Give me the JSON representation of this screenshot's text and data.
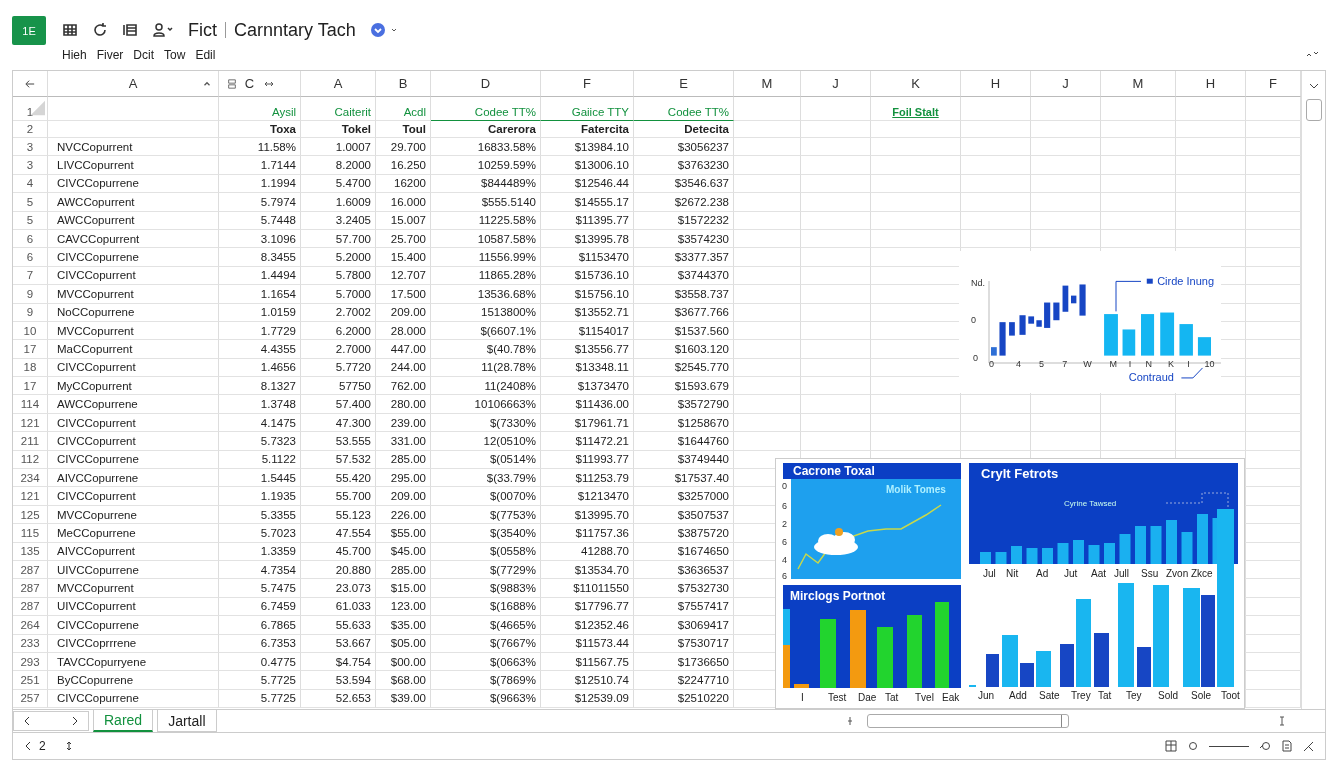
{
  "app": {
    "logo": "1E",
    "short_title": "Fict",
    "title": "Carnntary Tach"
  },
  "menu": [
    "Hieh",
    "Fiver",
    "Dcit",
    "Tow",
    "Edil"
  ],
  "sheet": {
    "columns": [
      "A",
      "C",
      "A",
      "B",
      "D",
      "F",
      "E",
      "M",
      "J",
      "K",
      "H",
      "J",
      "M",
      "H",
      "F"
    ],
    "header_rows": [
      {
        "row": "1",
        "kind": "accent",
        "cells": [
          "Aysil",
          "Caiterit",
          "Acdl",
          "Codee TT%",
          "Gaiice TTY",
          "Codee TT%"
        ],
        "link": "Foil Stalt"
      },
      {
        "row": "2",
        "kind": "bold",
        "cells": [
          "Toxa",
          "Tokel",
          "Toul",
          "Carerora",
          "Fatercita",
          "Detecita"
        ]
      }
    ],
    "rows": [
      {
        "row": "3",
        "name": "NVCCopurrent",
        "values": [
          "11.58%",
          "1.0007",
          "29.700",
          "16833.58%",
          "$13984.10",
          "$3056237"
        ]
      },
      {
        "row": "3",
        "name": "LIVCCopurrent",
        "values": [
          "1.7144",
          "8.2000",
          "16.250",
          "10259.59%",
          "$13006.10",
          "$3763230"
        ]
      },
      {
        "row": "4",
        "name": "CIVCCopurrene",
        "values": [
          "1.1994",
          "5.4700",
          "16200",
          "$844489%",
          "$12546.44",
          "$3546.637"
        ]
      },
      {
        "row": "5",
        "name": "AWCCopurrent",
        "values": [
          "5.7974",
          "1.6009",
          "16.000",
          "$555.5140",
          "$14555.17",
          "$2672.238"
        ]
      },
      {
        "row": "5",
        "name": "AWCCopurrent",
        "values": [
          "5.7448",
          "3.2405",
          "15.007",
          "11225.58%",
          "$11395.77",
          "$1572232"
        ]
      },
      {
        "row": "6",
        "name": "CAVCCopurrent",
        "values": [
          "3.1096",
          "57.700",
          "25.700",
          "10587.58%",
          "$13995.78",
          "$3574230"
        ]
      },
      {
        "row": "6",
        "name": "CIVCCopurrene",
        "values": [
          "8.3455",
          "5.2000",
          "15.400",
          "11556.99%",
          "$1153470",
          "$3377.357"
        ]
      },
      {
        "row": "7",
        "name": "CIVCCopurrent",
        "values": [
          "1.4494",
          "5.7800",
          "12.707",
          "11865.28%",
          "$15736.10",
          "$3744370"
        ]
      },
      {
        "row": "9",
        "name": "MVCCopurrent",
        "values": [
          "1.1654",
          "5.7000",
          "17.500",
          "13536.68%",
          "$15756.10",
          "$3558.737"
        ]
      },
      {
        "row": "9",
        "name": "NoCCopurrene",
        "values": [
          "1.0159",
          "2.7002",
          "209.00",
          "1513800%",
          "$13552.71",
          "$3677.766"
        ]
      },
      {
        "row": "10",
        "name": "MVCCopurrent",
        "values": [
          "1.7729",
          "6.2000",
          "28.000",
          "$(6607.1%",
          "$1154017",
          "$1537.560"
        ]
      },
      {
        "row": "17",
        "name": "MaCCopurrent",
        "values": [
          "4.4355",
          "2.7000",
          "447.00",
          "$(40.78%",
          "$13556.77",
          "$1603.120"
        ]
      },
      {
        "row": "18",
        "name": "CIVCCopurrent",
        "values": [
          "1.4656",
          "5.7720",
          "244.00",
          "11(28.78%",
          "$13348.11",
          "$2545.770"
        ]
      },
      {
        "row": "17",
        "name": "MyCCopurrent",
        "values": [
          "8.1327",
          "57750",
          "762.00",
          "11(2408%",
          "$1373470",
          "$1593.679"
        ]
      },
      {
        "row": "114",
        "name": "AWCCopurrene",
        "values": [
          "1.3748",
          "57.400",
          "280.00",
          "10106663%",
          "$11436.00",
          "$3572790"
        ]
      },
      {
        "row": "121",
        "name": "CIVCCopurrent",
        "values": [
          "4.1475",
          "47.300",
          "239.00",
          "$(7330%",
          "$17961.71",
          "$1258670"
        ]
      },
      {
        "row": "211",
        "name": "CIVCCopurrent",
        "values": [
          "5.7323",
          "53.555",
          "331.00",
          "12(0510%",
          "$11472.21",
          "$1644760"
        ]
      },
      {
        "row": "112",
        "name": "CIVCCopurrene",
        "values": [
          "5.1122",
          "57.532",
          "285.00",
          "$(0514%",
          "$11993.77",
          "$3749440"
        ]
      },
      {
        "row": "234",
        "name": "AIVCCopurrene",
        "values": [
          "1.5445",
          "55.420",
          "295.00",
          "$(33.79%",
          "$11253.79",
          "$17537.40"
        ]
      },
      {
        "row": "121",
        "name": "CIVCCopurrent",
        "values": [
          "1.1935",
          "55.700",
          "209.00",
          "$(0070%",
          "$1213470",
          "$3257000"
        ]
      },
      {
        "row": "125",
        "name": "MVCCopurrene",
        "values": [
          "5.3355",
          "55.123",
          "226.00",
          "$(7753%",
          "$13995.70",
          "$3507537"
        ]
      },
      {
        "row": "115",
        "name": "MeCCopurrene",
        "values": [
          "5.7023",
          "47.554",
          "$55.00",
          "$(3540%",
          "$11757.36",
          "$3875720"
        ]
      },
      {
        "row": "135",
        "name": "AIVCCopurrent",
        "values": [
          "1.3359",
          "45.700",
          "$45.00",
          "$(0558%",
          "41288.70",
          "$1674650"
        ]
      },
      {
        "row": "287",
        "name": "UIVCCopurrene",
        "values": [
          "4.7354",
          "20.880",
          "285.00",
          "$(7729%",
          "$13534.70",
          "$3636537"
        ]
      },
      {
        "row": "287",
        "name": "MVCCopurrent",
        "values": [
          "5.7475",
          "23.073",
          "$15.00",
          "$(9883%",
          "$11011550",
          "$7532730"
        ]
      },
      {
        "row": "287",
        "name": "UIVCCopurrent",
        "values": [
          "6.7459",
          "61.033",
          "123.00",
          "$(1688%",
          "$17796.77",
          "$7557417"
        ]
      },
      {
        "row": "264",
        "name": "CIVCCopurrene",
        "values": [
          "6.7865",
          "55.633",
          "$35.00",
          "$(4665%",
          "$12352.46",
          "$3069417"
        ]
      },
      {
        "row": "233",
        "name": "CIVCCoprrrene",
        "values": [
          "6.7353",
          "53.667",
          "$05.00",
          "$(7667%",
          "$11573.44",
          "$7530717"
        ]
      },
      {
        "row": "293",
        "name": "TAVCCopurryene",
        "values": [
          "0.4775",
          "$4.754",
          "$00.00",
          "$(0663%",
          "$11567.75",
          "$1736650"
        ]
      },
      {
        "row": "251",
        "name": "ByCCopurrene",
        "values": [
          "5.7725",
          "53.594",
          "$68.00",
          "$(7869%",
          "$12510.74",
          "$2247710"
        ]
      },
      {
        "row": "257",
        "name": "CIVCCopurrene",
        "values": [
          "5.7725",
          "52.653",
          "$39.00",
          "$(9663%",
          "$12539.09",
          "$2510220"
        ]
      }
    ]
  },
  "small_chart": {
    "y_labels": [
      "Nd.",
      "0",
      "0"
    ],
    "x_labels": [
      "0",
      "4",
      "5",
      "7",
      "W",
      "M",
      "I",
      "N",
      "K",
      "I",
      "10"
    ],
    "legend": "Cirde Inung",
    "note": "Contraud"
  },
  "dashboard": {
    "line_panel": {
      "title": "Cacrone Toxal",
      "y_ticks": [
        "0",
        "6",
        "2",
        "6",
        "4",
        "6"
      ],
      "label": "Molik Tomes"
    },
    "bar_panel": {
      "title": "Crylt Fetrots",
      "note": "Cyrine Tawsed",
      "x_labels": [
        "Jul",
        "Nit",
        "Ad",
        "Jut",
        "Aat",
        "Jull",
        "Ssu",
        "Zvon",
        "Zkce"
      ]
    },
    "mix_panel": {
      "title": "Mirclogs Portnot",
      "x_labels": [
        "I",
        "Test",
        "Dae",
        "Tat",
        "Tvel",
        "Eak"
      ]
    },
    "lower_x_labels": [
      "Jun",
      "Add",
      "Sate",
      "Trey",
      "Tat",
      "Tey",
      "Sold",
      "Sole",
      "Toot"
    ]
  },
  "sheet_tabs": [
    {
      "label": "Rared",
      "selected": true
    },
    {
      "label": "Jartall",
      "selected": false
    }
  ],
  "status": {
    "page": "2"
  }
}
